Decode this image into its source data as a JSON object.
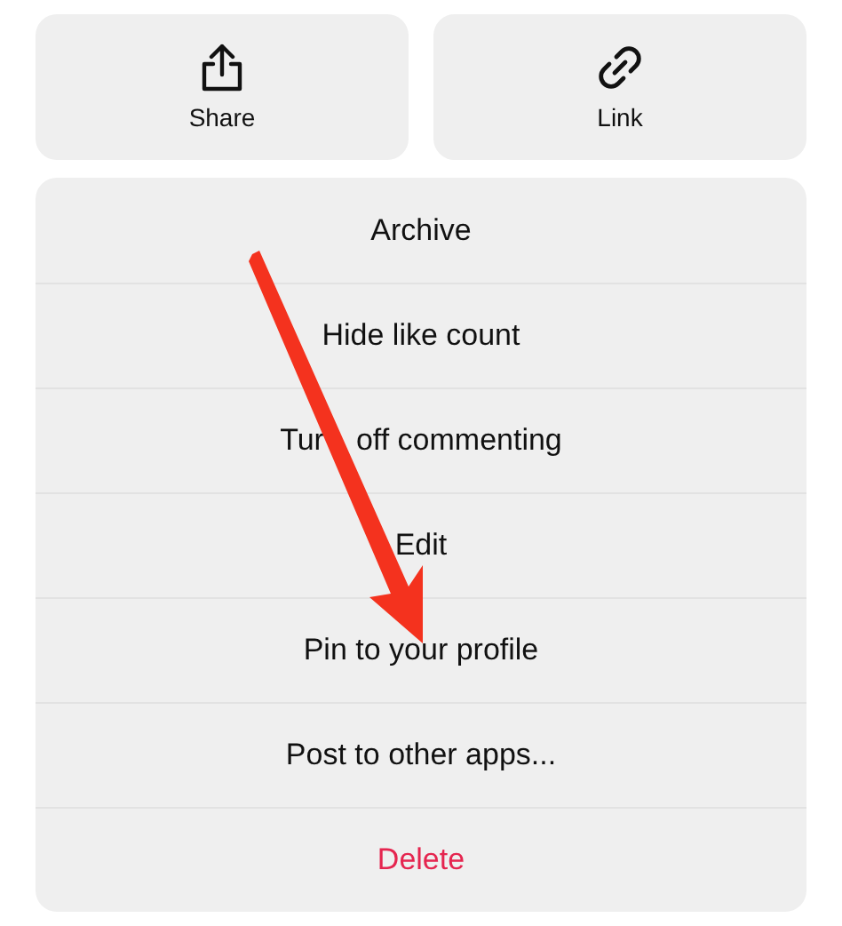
{
  "actions": [
    {
      "label": "Share",
      "kind": "share"
    },
    {
      "label": "Link",
      "kind": "link"
    }
  ],
  "menu": [
    {
      "label": "Archive",
      "kind": "normal"
    },
    {
      "label": "Hide like count",
      "kind": "normal"
    },
    {
      "label": "Tur",
      "label_after_arrow": "off commenting",
      "kind": "normal"
    },
    {
      "label": "Edit",
      "kind": "normal"
    },
    {
      "label": "Pin to your profile",
      "kind": "normal"
    },
    {
      "label": "Post to other apps...",
      "kind": "normal"
    },
    {
      "label": "Delete",
      "kind": "destructive"
    }
  ]
}
